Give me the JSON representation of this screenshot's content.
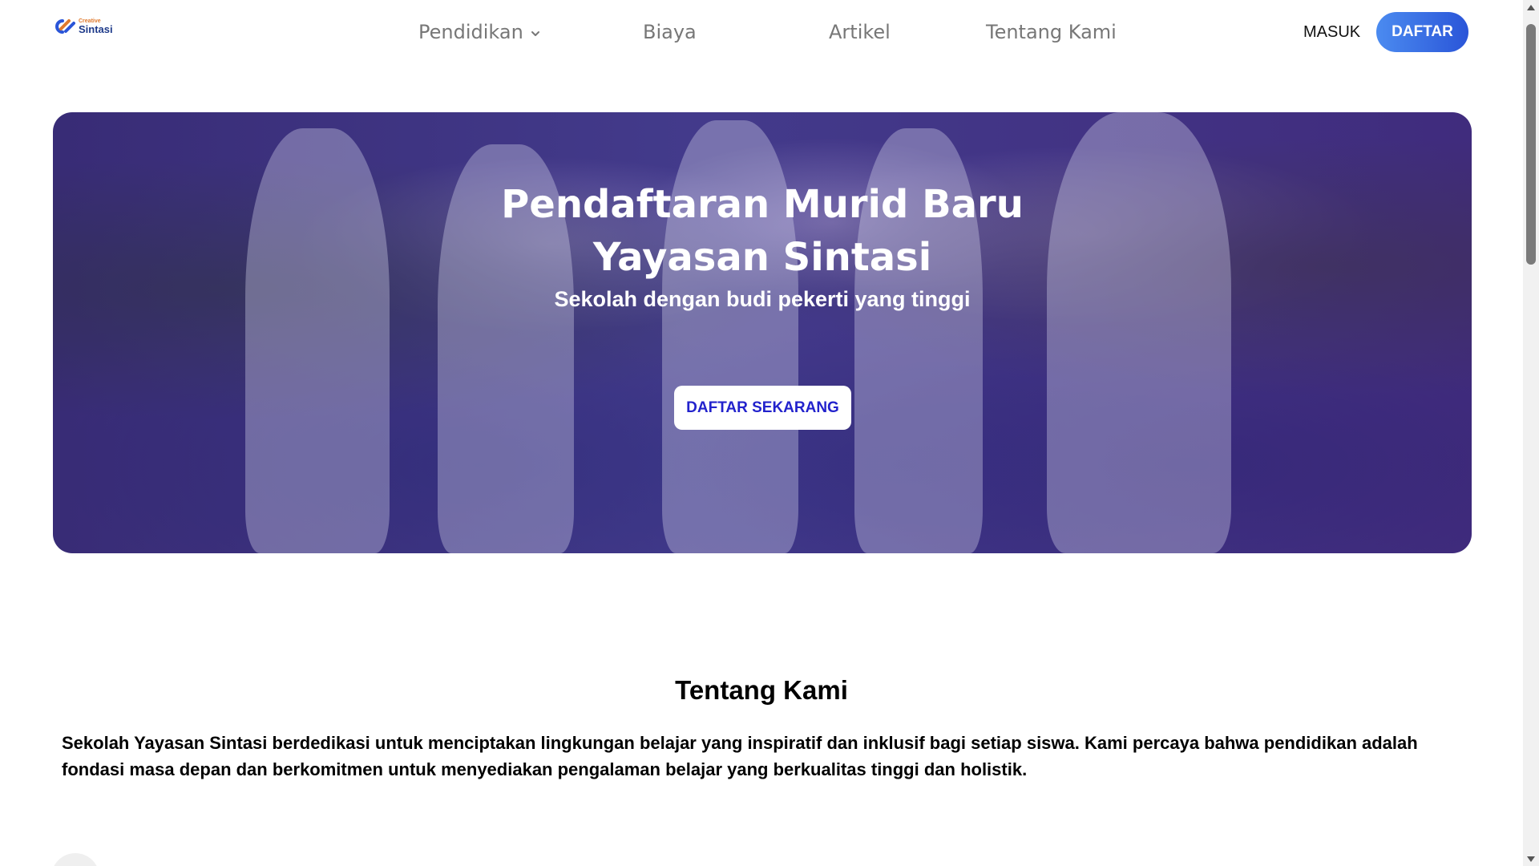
{
  "brand": {
    "small": "Creative",
    "name": "Sintasi",
    "logo_icon": "sintasi-logo-icon",
    "colors": {
      "primary": "#2a55d8",
      "accent": "#e07a2e"
    }
  },
  "nav": {
    "items": [
      {
        "label": "Pendidikan",
        "has_dropdown": true,
        "icon": "chevron-down-icon"
      },
      {
        "label": "Biaya"
      },
      {
        "label": "Artikel"
      },
      {
        "label": "Tentang Kami"
      }
    ],
    "login_label": "MASUK",
    "register_label": "DAFTAR"
  },
  "hero": {
    "title_line1": "Pendaftaran Murid Baru",
    "title_line2": "Yayasan Sintasi",
    "subtitle": "Sekolah dengan budi pekerti yang tinggi",
    "cta_label": "DAFTAR SEKARANG",
    "cta_color": "#2222cc"
  },
  "about": {
    "title": "Tentang Kami",
    "text": "Sekolah Yayasan Sintasi berdedikasi untuk menciptakan lingkungan belajar yang inspiratif dan inklusif bagi setiap siswa. Kami percaya bahwa pendidikan adalah fondasi masa depan dan berkomitmen untuk menyediakan pengalaman belajar yang berkualitas tinggi dan holistik."
  }
}
